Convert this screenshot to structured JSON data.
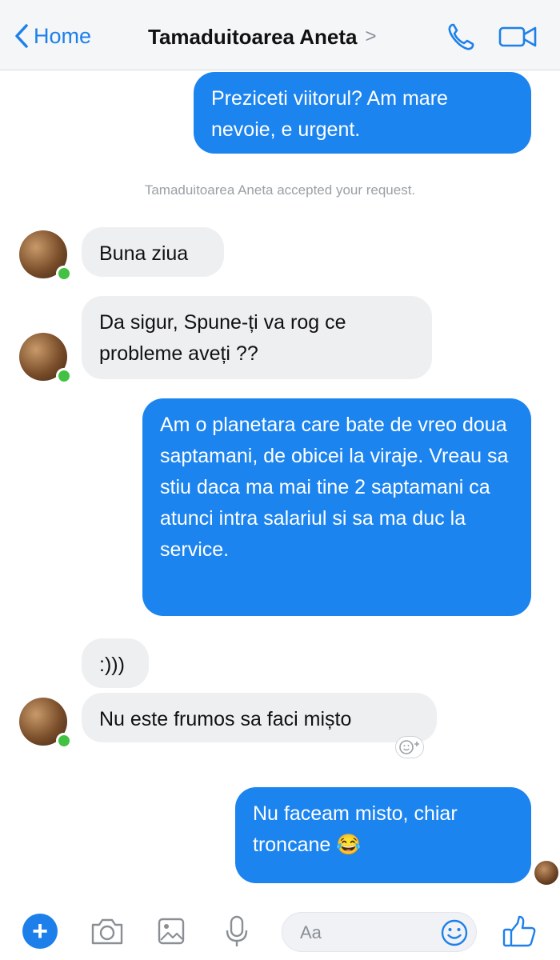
{
  "header": {
    "back_label": "Home",
    "contact_name": "Tamaduitoarea Aneta",
    "contact_arrow": ">"
  },
  "messages": [
    {
      "from": "me",
      "text": "Preziceti viitorul? Am mare nevoie, e urgent."
    },
    {
      "type": "system",
      "text": "Tamaduitoarea Aneta accepted your request."
    },
    {
      "from": "them",
      "text": "Buna ziua"
    },
    {
      "from": "them",
      "text": "Da sigur, Spune-ți va rog ce probleme aveți ??"
    },
    {
      "from": "me",
      "text": "Am o planetara care bate de vreo doua saptamani, de obicei la viraje. Vreau sa stiu daca ma mai tine 2 saptamani ca atunci intra salariul si sa ma duc la service."
    },
    {
      "from": "them",
      "text": ":)))"
    },
    {
      "from": "them",
      "text": "Nu este frumos sa faci mișto"
    },
    {
      "from": "me",
      "text": "Nu faceam misto, chiar troncane 😂"
    }
  ],
  "composer": {
    "placeholder": "Aa"
  },
  "colors": {
    "accent": "#1d80ea",
    "outgoing_bubble": "#1c84ef",
    "incoming_bubble": "#eeeff1",
    "online": "#43c142"
  },
  "icons": [
    "chevron-left-icon",
    "phone-icon",
    "video-camera-icon",
    "plus-icon",
    "camera-icon",
    "image-icon",
    "microphone-icon",
    "emoji-icon",
    "thumbs-up-icon",
    "add-reaction-icon"
  ]
}
